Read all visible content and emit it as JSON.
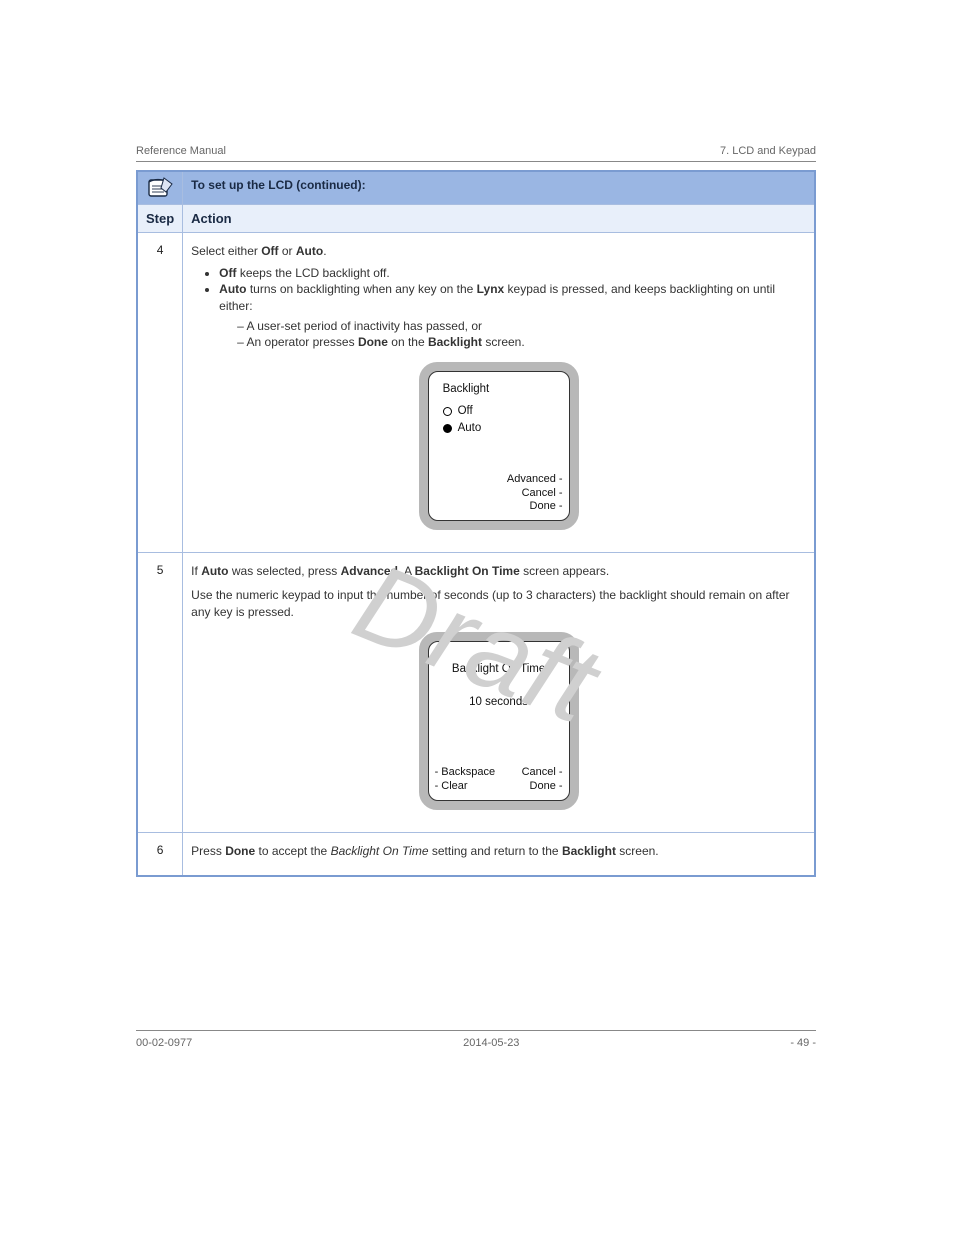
{
  "header": {
    "left": "Reference Manual",
    "right": "7. LCD and Keypad"
  },
  "watermark": "Draft",
  "table": {
    "title": "To set up the LCD (continued):",
    "col_step": "Step",
    "col_action": "Action",
    "step4": {
      "num": "4",
      "lead": "Select either Off or Auto.",
      "bullets": [
        "Off keeps the LCD backlight off.",
        "Auto turns on backlighting when any key on the Lynx keypad is pressed, and keeps backlighting on until either:"
      ],
      "sub": [
        "A user-set period of inactivity has passed, or",
        "An operator presses Done on the Backlight screen."
      ],
      "screen": {
        "title": "Backlight",
        "opt_off": "Off",
        "opt_auto": "Auto",
        "act_advanced": "Advanced -",
        "act_cancel": "Cancel -",
        "act_done": "Done -"
      }
    },
    "step5": {
      "num": "5",
      "lead_a": "If ",
      "lead_auto": "Auto",
      "lead_b": " was selected, press ",
      "lead_adv": "Advanced",
      "lead_c": ". A ",
      "lead_bot": "Backlight On Time",
      "lead_d": " screen appears.",
      "p2": "Use the numeric keypad to input the number of seconds (up to 3 characters) the backlight should remain on after any key is pressed.",
      "screen": {
        "title": "Backlight On Time",
        "value": "10 seconds",
        "act_backspace": "- Backspace",
        "act_clear": "- Clear",
        "act_cancel": "Cancel -",
        "act_done": "Done -"
      }
    },
    "step6": {
      "num": "6",
      "body": "Press Done to accept the Backlight On Time setting and return to the Backlight screen."
    }
  },
  "footer": {
    "left": "00-02-0977",
    "center": "2014-05-23",
    "right": "- 49 -"
  }
}
